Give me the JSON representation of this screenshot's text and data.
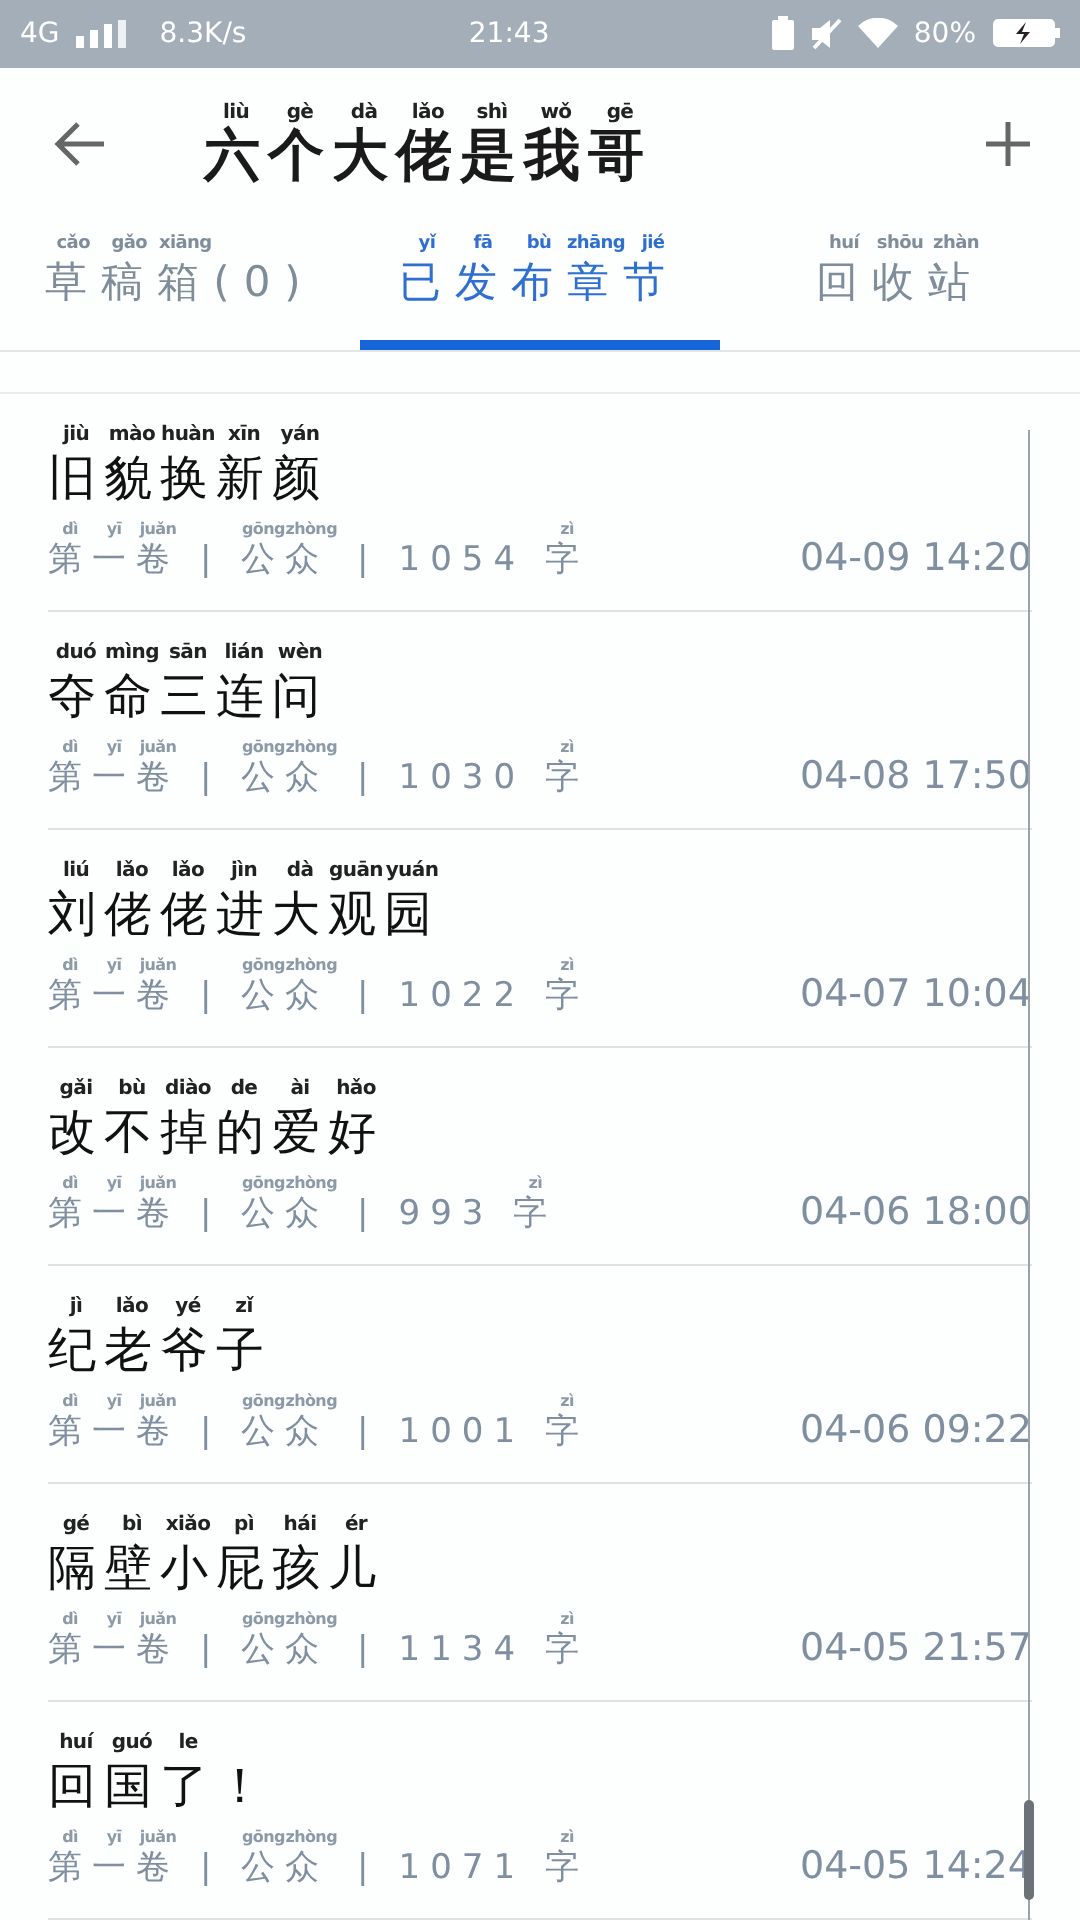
{
  "status_bar": {
    "network": "4G",
    "speed": "8.3K/s",
    "time": "21:43",
    "battery": "80%"
  },
  "header": {
    "title": "六个大佬是我哥",
    "pinyin": [
      "liù",
      "gè",
      "dà",
      "lǎo",
      "shì",
      "wǒ",
      "gē"
    ]
  },
  "tabs": [
    {
      "label": "草稿箱(0)",
      "pinyin": [
        "cǎo",
        "gǎo",
        "xiāng"
      ],
      "selected": false
    },
    {
      "label": "已发布章节",
      "pinyin": [
        "yǐ",
        "fā",
        "bù",
        "zhāng",
        "jié"
      ],
      "selected": true
    },
    {
      "label": "回收站",
      "pinyin": [
        "huí",
        "shōu",
        "zhàn"
      ],
      "selected": false
    }
  ],
  "chapters": [
    {
      "title": "旧貌换新颜",
      "pinyin": [
        "jiù",
        "mào",
        "huàn",
        "xīn",
        "yán"
      ],
      "meta": [
        {
          "text": "第一卷",
          "pinyin": [
            "dì",
            "yī",
            "juǎn"
          ]
        },
        {
          "text": "|"
        },
        {
          "text": "公众",
          "pinyin": [
            "gōng",
            "zhòng"
          ]
        },
        {
          "text": "|"
        },
        {
          "text": "1054"
        },
        {
          "text": "字",
          "pinyin": [
            "zì"
          ]
        }
      ],
      "date": "04-09 14:20"
    },
    {
      "title": "夺命三连问",
      "pinyin": [
        "duó",
        "mìng",
        "sān",
        "lián",
        "wèn"
      ],
      "meta": [
        {
          "text": "第一卷",
          "pinyin": [
            "dì",
            "yī",
            "juǎn"
          ]
        },
        {
          "text": "|"
        },
        {
          "text": "公众",
          "pinyin": [
            "gōng",
            "zhòng"
          ]
        },
        {
          "text": "|"
        },
        {
          "text": "1030"
        },
        {
          "text": "字",
          "pinyin": [
            "zì"
          ]
        }
      ],
      "date": "04-08 17:50"
    },
    {
      "title": "刘佬佬进大观园",
      "pinyin": [
        "liú",
        "lǎo",
        "lǎo",
        "jìn",
        "dà",
        "guān",
        "yuán"
      ],
      "meta": [
        {
          "text": "第一卷",
          "pinyin": [
            "dì",
            "yī",
            "juǎn"
          ]
        },
        {
          "text": "|"
        },
        {
          "text": "公众",
          "pinyin": [
            "gōng",
            "zhòng"
          ]
        },
        {
          "text": "|"
        },
        {
          "text": "1022"
        },
        {
          "text": "字",
          "pinyin": [
            "zì"
          ]
        }
      ],
      "date": "04-07 10:04"
    },
    {
      "title": "改不掉的爱好",
      "pinyin": [
        "gǎi",
        "bù",
        "diào",
        "de",
        "ài",
        "hǎo"
      ],
      "meta": [
        {
          "text": "第一卷",
          "pinyin": [
            "dì",
            "yī",
            "juǎn"
          ]
        },
        {
          "text": "|"
        },
        {
          "text": "公众",
          "pinyin": [
            "gōng",
            "zhòng"
          ]
        },
        {
          "text": "|"
        },
        {
          "text": "993"
        },
        {
          "text": "字",
          "pinyin": [
            "zì"
          ]
        }
      ],
      "date": "04-06 18:00"
    },
    {
      "title": "纪老爷子",
      "pinyin": [
        "jì",
        "lǎo",
        "yé",
        "zǐ"
      ],
      "meta": [
        {
          "text": "第一卷",
          "pinyin": [
            "dì",
            "yī",
            "juǎn"
          ]
        },
        {
          "text": "|"
        },
        {
          "text": "公众",
          "pinyin": [
            "gōng",
            "zhòng"
          ]
        },
        {
          "text": "|"
        },
        {
          "text": "1001"
        },
        {
          "text": "字",
          "pinyin": [
            "zì"
          ]
        }
      ],
      "date": "04-06 09:22"
    },
    {
      "title": "隔壁小屁孩儿",
      "pinyin": [
        "gé",
        "bì",
        "xiǎo",
        "pì",
        "hái",
        "ér"
      ],
      "meta": [
        {
          "text": "第一卷",
          "pinyin": [
            "dì",
            "yī",
            "juǎn"
          ]
        },
        {
          "text": "|"
        },
        {
          "text": "公众",
          "pinyin": [
            "gōng",
            "zhòng"
          ]
        },
        {
          "text": "|"
        },
        {
          "text": "1134"
        },
        {
          "text": "字",
          "pinyin": [
            "zì"
          ]
        }
      ],
      "date": "04-05 21:57"
    },
    {
      "title": "回国了！",
      "pinyin": [
        "huí",
        "guó",
        "le"
      ],
      "meta": [
        {
          "text": "第一卷",
          "pinyin": [
            "dì",
            "yī",
            "juǎn"
          ]
        },
        {
          "text": "|"
        },
        {
          "text": "公众",
          "pinyin": [
            "gōng",
            "zhòng"
          ]
        },
        {
          "text": "|"
        },
        {
          "text": "1071"
        },
        {
          "text": "字",
          "pinyin": [
            "zì"
          ]
        }
      ],
      "date": "04-05 14:24"
    }
  ]
}
